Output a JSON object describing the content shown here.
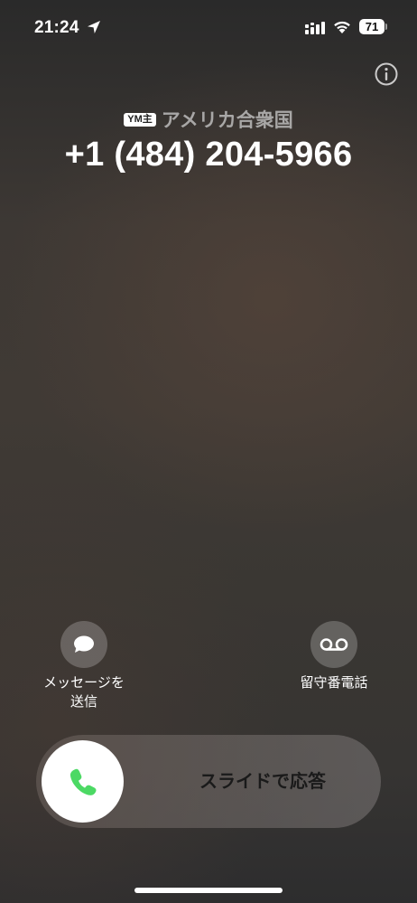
{
  "status_bar": {
    "time": "21:24",
    "battery_level": "71",
    "icons": [
      "location-arrow-icon",
      "signal-icon",
      "wifi-icon",
      "battery-icon"
    ]
  },
  "caller": {
    "line_badge": "YM主",
    "region": "アメリカ合衆国",
    "number": "+1 (484) 204-5966"
  },
  "actions": {
    "message": {
      "label_line1": "メッセージを",
      "label_line2": "送信",
      "icon": "message-bubble-icon"
    },
    "voicemail": {
      "label": "留守番電話",
      "icon": "voicemail-icon"
    }
  },
  "slider": {
    "label": "スライドで応答",
    "icon": "phone-icon",
    "knob_color": "#ffffff",
    "icon_color": "#4cd964"
  },
  "colors": {
    "accept_green": "#4cd964"
  }
}
